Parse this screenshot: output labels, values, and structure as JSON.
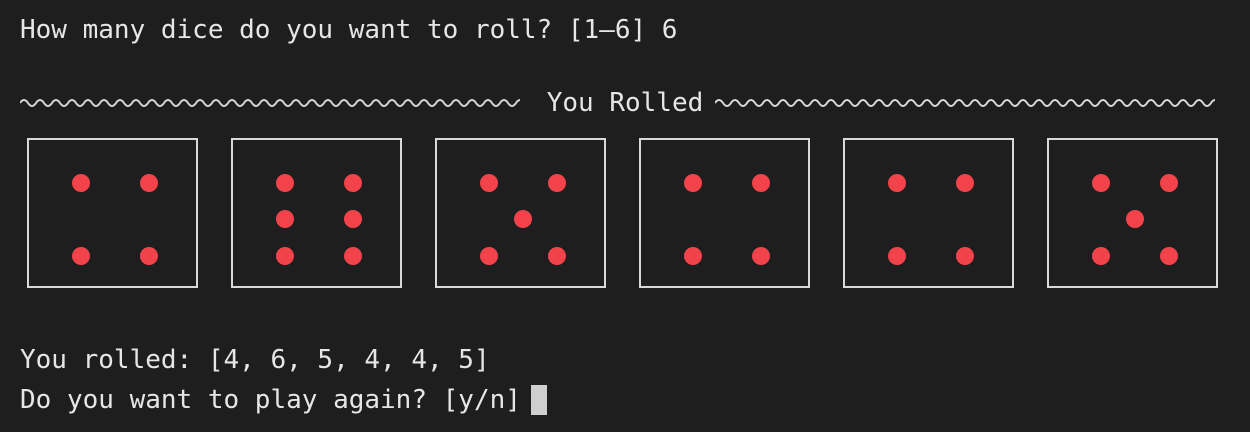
{
  "terminal": {
    "prompt_text": "How many dice do you want to roll? [1–6]",
    "prompt_answer": "6",
    "header_title": "You Rolled",
    "rolls": [
      4,
      6,
      5,
      4,
      4,
      5
    ],
    "result_text": "You rolled: [4, 6, 5, 4, 4, 5]",
    "again_text": "Do you want to play again? [y/n]"
  },
  "colors": {
    "background": "#1e1e1e",
    "text": "#e6e6e6",
    "pip": "#f2434b",
    "die_border": "#d9d9d9",
    "cursor": "#cfcfcf"
  }
}
